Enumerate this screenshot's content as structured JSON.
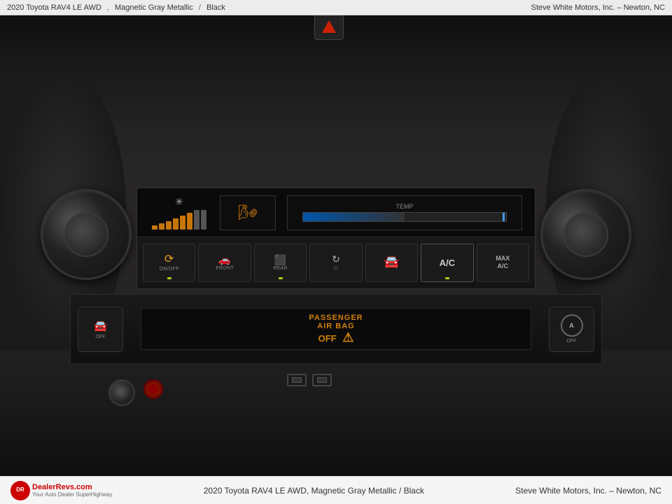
{
  "title": {
    "car": "2020 Toyota RAV4 LE AWD",
    "color1": "Magnetic Gray Metallic",
    "separator": "/",
    "color2": "Black",
    "dealer": "Steve White Motors, Inc. – Newton, NC"
  },
  "hvac": {
    "fan_bars": [
      4,
      8,
      12,
      16,
      20,
      24,
      28,
      32
    ],
    "on_off_label": "ON/OFF",
    "front_label": "FRONT",
    "rear_label": "REAR",
    "ac_label": "A/C",
    "max_ac_label": "MAX\nA/C"
  },
  "airbag": {
    "line1": "PASSENGER",
    "line2": "AIR BAG",
    "status": "OFF"
  },
  "dealer": {
    "name": "DealerRevs.com",
    "tagline": "Your Auto Dealer SuperHighway",
    "logo_text": "DR",
    "contact": "Steve White Motors, Inc. – Newton, NC",
    "car_info": "2020 Toyota RAV4 LE AWD,   Magnetic Gray Metallic / Black"
  },
  "colors": {
    "accent_orange": "#c8760a",
    "brand_red": "#cc0000",
    "text_dark": "#333333",
    "bg_bar": "#f5f5f5"
  }
}
